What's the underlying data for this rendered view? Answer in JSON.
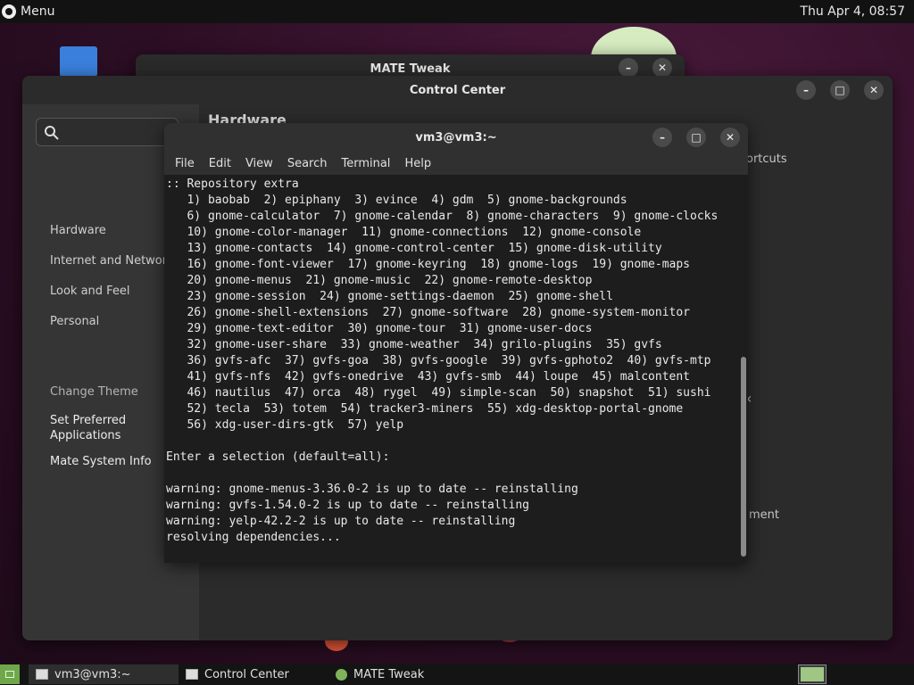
{
  "top_panel": {
    "menu_label": "Menu",
    "clock": "Thu Apr  4, 08:57"
  },
  "mate_tweak": {
    "title": "MATE Tweak",
    "minimize": "–",
    "close": "✕"
  },
  "control_center": {
    "title": "Control Center",
    "minimize": "–",
    "maximize": "□",
    "close": "✕",
    "heading": "Hardware",
    "categories": [
      "Hardware",
      "Internet and Network",
      "Look and Feel",
      "Personal"
    ],
    "extras": [
      "Change Theme",
      "Set Preferred Applications",
      "Mate System Info"
    ],
    "frag_shortcuts": "ortcuts",
    "frag_chevron": "‹",
    "frag_ment": "ment"
  },
  "terminal": {
    "title": "vm3@vm3:~",
    "minimize": "–",
    "maximize": "□",
    "close": "✕",
    "menu": [
      "File",
      "Edit",
      "View",
      "Search",
      "Terminal",
      "Help"
    ],
    "lines": [
      ":: Repository extra",
      "   1) baobab  2) epiphany  3) evince  4) gdm  5) gnome-backgrounds",
      "   6) gnome-calculator  7) gnome-calendar  8) gnome-characters  9) gnome-clocks",
      "   10) gnome-color-manager  11) gnome-connections  12) gnome-console",
      "   13) gnome-contacts  14) gnome-control-center  15) gnome-disk-utility",
      "   16) gnome-font-viewer  17) gnome-keyring  18) gnome-logs  19) gnome-maps",
      "   20) gnome-menus  21) gnome-music  22) gnome-remote-desktop",
      "   23) gnome-session  24) gnome-settings-daemon  25) gnome-shell",
      "   26) gnome-shell-extensions  27) gnome-software  28) gnome-system-monitor",
      "   29) gnome-text-editor  30) gnome-tour  31) gnome-user-docs",
      "   32) gnome-user-share  33) gnome-weather  34) grilo-plugins  35) gvfs",
      "   36) gvfs-afc  37) gvfs-goa  38) gvfs-google  39) gvfs-gphoto2  40) gvfs-mtp",
      "   41) gvfs-nfs  42) gvfs-onedrive  43) gvfs-smb  44) loupe  45) malcontent",
      "   46) nautilus  47) orca  48) rygel  49) simple-scan  50) snapshot  51) sushi",
      "   52) tecla  53) totem  54) tracker3-miners  55) xdg-desktop-portal-gnome",
      "   56) xdg-user-dirs-gtk  57) yelp",
      "",
      "Enter a selection (default=all):",
      "",
      "warning: gnome-menus-3.36.0-2 is up to date -- reinstalling",
      "warning: gvfs-1.54.0-2 is up to date -- reinstalling",
      "warning: yelp-42.2-2 is up to date -- reinstalling",
      "resolving dependencies..."
    ]
  },
  "taskbar": {
    "tasks": [
      "vm3@vm3:~",
      "Control Center",
      "MATE Tweak"
    ]
  }
}
